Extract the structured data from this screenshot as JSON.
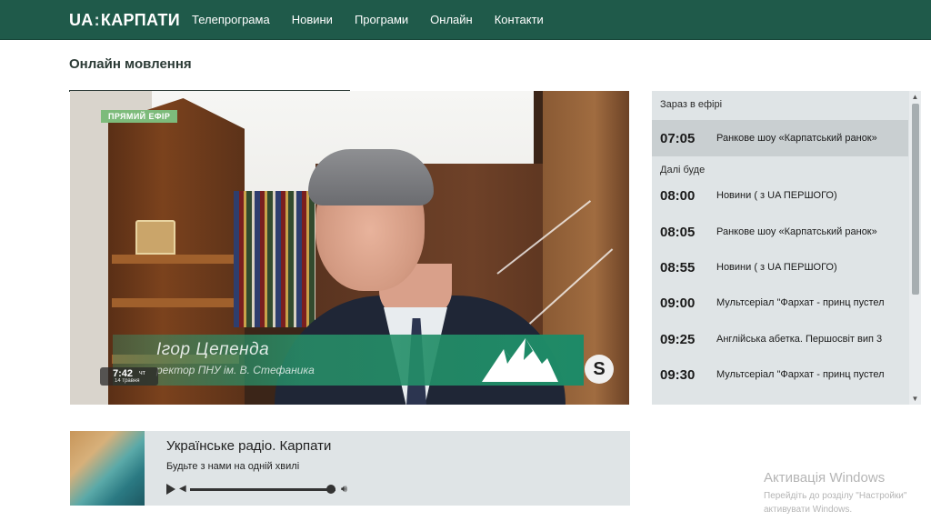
{
  "header": {
    "logo_ua": "UA",
    "logo_colon": ":",
    "logo_name": "КАРПАТИ",
    "nav": [
      {
        "label": "Телепрограма"
      },
      {
        "label": "Новини"
      },
      {
        "label": "Програми"
      },
      {
        "label": "Онлайн"
      },
      {
        "label": "Контакти"
      }
    ]
  },
  "page": {
    "title": "Онлайн мовлення"
  },
  "video": {
    "live_label": "ПРЯМИЙ ЕФІР",
    "speaker_name": "Ігор Цепенда",
    "speaker_role": "ректор ПНУ ім. В. Стефаника",
    "clock_time": "7:42",
    "clock_day": "чт",
    "clock_date": "14 травня",
    "skype_letter": "S"
  },
  "schedule": {
    "now_heading": "Зараз в ефірі",
    "now": {
      "time": "07:05",
      "title": "Ранкове шоу «Карпатський ранок»"
    },
    "next_heading": "Далі буде",
    "items": [
      {
        "time": "08:00",
        "title": "Новини ( з UA ПЕРШОГО)"
      },
      {
        "time": "08:05",
        "title": "Ранкове шоу «Карпатський ранок»"
      },
      {
        "time": "08:55",
        "title": "Новини ( з UA ПЕРШОГО)"
      },
      {
        "time": "09:00",
        "title": "Мультсеріал \"Фархат - принц пустел"
      },
      {
        "time": "09:25",
        "title": "Англійська абетка. Першосвіт вип 3"
      },
      {
        "time": "09:30",
        "title": "Мультсеріал \"Фархат - принц пустел"
      }
    ]
  },
  "radio": {
    "title": "Українське радіо. Карпати",
    "subtitle": "Будьте з нами на одній хвилі",
    "progress": 0.97
  },
  "watermark": {
    "title": "Активація Windows",
    "line1": "Перейдіть до розділу \"Настройки\"",
    "line2": "активувати Windows."
  },
  "colors": {
    "header_bg": "#1f5a4a",
    "panel_bg": "#dfe4e6",
    "live_badge": "#7dbb7b",
    "lower_third": "#1d8a67"
  }
}
